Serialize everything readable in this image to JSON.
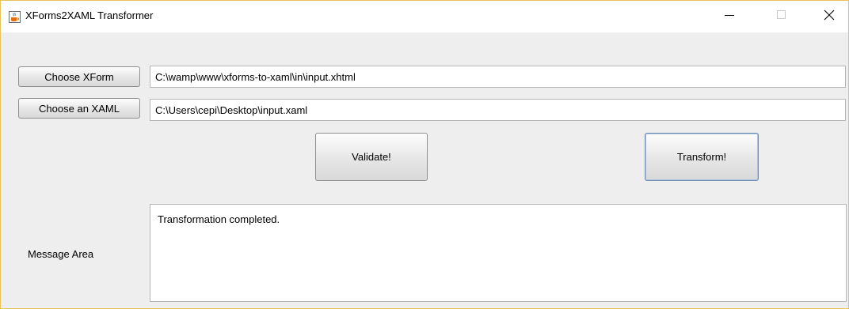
{
  "window": {
    "title": "XForms2XAML Transformer",
    "icon": "java-cup-icon",
    "controls": [
      "minimize-icon",
      "maximize-icon",
      "close-icon"
    ]
  },
  "form": {
    "choose_xform_label": "Choose XForm",
    "xform_path": "C:\\wamp\\www\\xforms-to-xaml\\in\\input.xhtml",
    "choose_xaml_label": "Choose an XAML",
    "xaml_path": "C:\\Users\\cepi\\Desktop\\input.xaml"
  },
  "actions": {
    "validate_label": "Validate!",
    "transform_label": "Transform!"
  },
  "messages": {
    "label": "Message Area",
    "text": "Transformation completed."
  },
  "colors": {
    "window_bg": "#eeeeee",
    "titlebar_bg": "#ffffff",
    "focus_border": "#6f8fb8"
  }
}
